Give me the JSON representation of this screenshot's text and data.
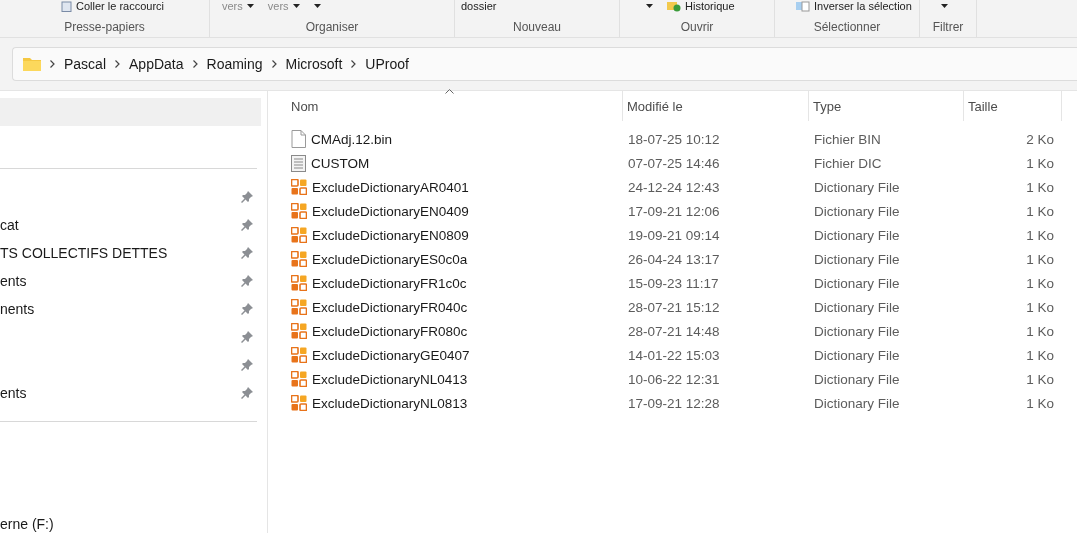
{
  "ribbon": {
    "groups": [
      {
        "label": "Presse-papiers",
        "items": [
          {
            "label": "Coller le raccourci",
            "caret": false
          }
        ]
      },
      {
        "label": "Organiser",
        "items": [
          {
            "label": "vers",
            "caret": true
          },
          {
            "label": "vers",
            "caret": true
          },
          {
            "caret": true
          }
        ]
      },
      {
        "label": "Nouveau",
        "items": [
          {
            "label": "dossier",
            "caret": false
          }
        ]
      },
      {
        "label": "Ouvrir",
        "items": [
          {
            "caret": true
          },
          {
            "label": "Historique",
            "caret": false
          }
        ]
      },
      {
        "label": "Sélectionner",
        "items": [
          {
            "label": "Inverser la sélection",
            "caret": false
          }
        ]
      },
      {
        "label": "Filtrer",
        "items": [
          {
            "caret": true
          }
        ]
      }
    ]
  },
  "address_bar": {
    "crumbs": [
      "Pascal",
      "AppData",
      "Roaming",
      "Microsoft",
      "UProof"
    ]
  },
  "sidebar": {
    "groups": [
      {
        "items": [
          {
            "selected": true
          }
        ]
      },
      {
        "items": [
          {
            "selected": false,
            "pinned": true
          },
          {
            "label": "cat",
            "selected": false,
            "pinned": true
          },
          {
            "label": "TS COLLECTIFS DETTES",
            "selected": false,
            "pinned": true
          },
          {
            "label": "ents",
            "selected": false,
            "pinned": true
          },
          {
            "label": "nents",
            "selected": false,
            "pinned": true
          },
          {
            "selected": false,
            "pinned": true
          },
          {
            "selected": false,
            "pinned": true
          },
          {
            "label": "ents",
            "selected": false,
            "pinned": true
          }
        ]
      },
      {
        "items": [
          {
            "label": "erne (F:)",
            "selected": false
          }
        ]
      }
    ]
  },
  "file_list": {
    "columns": [
      {
        "label": "Nom",
        "sorted": true
      },
      {
        "label": "Modifié le",
        "sorted": false
      },
      {
        "label": "Type",
        "sorted": false
      },
      {
        "label": "Taille",
        "sorted": false
      }
    ],
    "rows": [
      {
        "kind": "blank",
        "name": "CMAdj.12.bin",
        "modified": "18-07-25 10:12",
        "type": "Fichier BIN",
        "size": "2 Ko"
      },
      {
        "kind": "text",
        "name": "CUSTOM",
        "modified": "07-07-25 14:46",
        "type": "Fichier DIC",
        "size": "1 Ko"
      },
      {
        "kind": "dictionary",
        "name": "ExcludeDictionaryAR0401",
        "modified": "24-12-24 12:43",
        "type": "Dictionary File",
        "size": "1 Ko"
      },
      {
        "kind": "dictionary",
        "name": "ExcludeDictionaryEN0409",
        "modified": "17-09-21 12:06",
        "type": "Dictionary File",
        "size": "1 Ko"
      },
      {
        "kind": "dictionary",
        "name": "ExcludeDictionaryEN0809",
        "modified": "19-09-21 09:14",
        "type": "Dictionary File",
        "size": "1 Ko"
      },
      {
        "kind": "dictionary",
        "name": "ExcludeDictionaryES0c0a",
        "modified": "26-04-24 13:17",
        "type": "Dictionary File",
        "size": "1 Ko"
      },
      {
        "kind": "dictionary",
        "name": "ExcludeDictionaryFR1c0c",
        "modified": "15-09-23 11:17",
        "type": "Dictionary File",
        "size": "1 Ko"
      },
      {
        "kind": "dictionary",
        "name": "ExcludeDictionaryFR040c",
        "modified": "28-07-21 15:12",
        "type": "Dictionary File",
        "size": "1 Ko"
      },
      {
        "kind": "dictionary",
        "name": "ExcludeDictionaryFR080c",
        "modified": "28-07-21 14:48",
        "type": "Dictionary File",
        "size": "1 Ko"
      },
      {
        "kind": "dictionary",
        "name": "ExcludeDictionaryGE0407",
        "modified": "14-01-22 15:03",
        "type": "Dictionary File",
        "size": "1 Ko"
      },
      {
        "kind": "dictionary",
        "name": "ExcludeDictionaryNL0413",
        "modified": "10-06-22 12:31",
        "type": "Dictionary File",
        "size": "1 Ko"
      },
      {
        "kind": "dictionary",
        "name": "ExcludeDictionaryNL0813",
        "modified": "17-09-21 12:28",
        "type": "Dictionary File",
        "size": "1 Ko"
      }
    ]
  }
}
